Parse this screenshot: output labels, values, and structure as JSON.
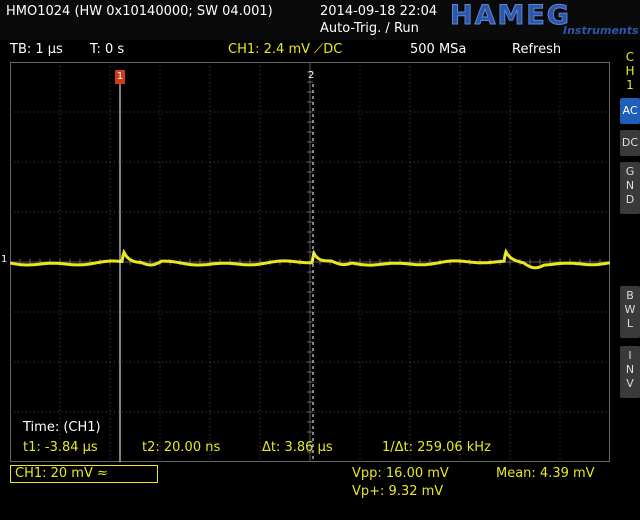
{
  "header": {
    "device": "HMO1024 (HW 0x10140000; SW 04.001)",
    "datetime": "2014-09-18 22:04",
    "trigger_mode": "Auto-Trig. / Run",
    "brand": "HAMEG",
    "brand_sub": "Instruments"
  },
  "status": {
    "timebase": "TB: 1 µs",
    "trigger_time": "T: 0 s",
    "trigger_setting": "CH1: 2.4 mV ⟋DC",
    "sample_rate": "500 MSa",
    "refresh": "Refresh"
  },
  "markers": {
    "cursor1_label": "1",
    "cursor2_label": "2",
    "channel_ref": "1"
  },
  "measurements": {
    "time_title": "Time: (CH1)",
    "t1": "t1: -3.84 µs",
    "t2": "t2: 20.00 ns",
    "dt": "Δt: 3.86 µs",
    "inv_dt": "1/Δt: 259.06 kHz"
  },
  "bottom": {
    "ch1_setting": "CH1: 20 mV ≈",
    "vpp": "Vpp: 16.00 mV",
    "vp_plus": "Vp+: 9.32 mV",
    "mean": "Mean: 4.39 mV"
  },
  "sidebar": {
    "channel": [
      "C",
      "H",
      "1"
    ],
    "ac": "AC",
    "dc": "DC",
    "gnd": [
      "G",
      "N",
      "D"
    ],
    "bwl": [
      "B",
      "W",
      "L"
    ],
    "inv": [
      "I",
      "N",
      "V"
    ]
  },
  "colors": {
    "trace": "#e8e820",
    "grid": "#4a4a4a",
    "brand": "#2d56a8",
    "active_button": "#1f5fb8"
  }
}
